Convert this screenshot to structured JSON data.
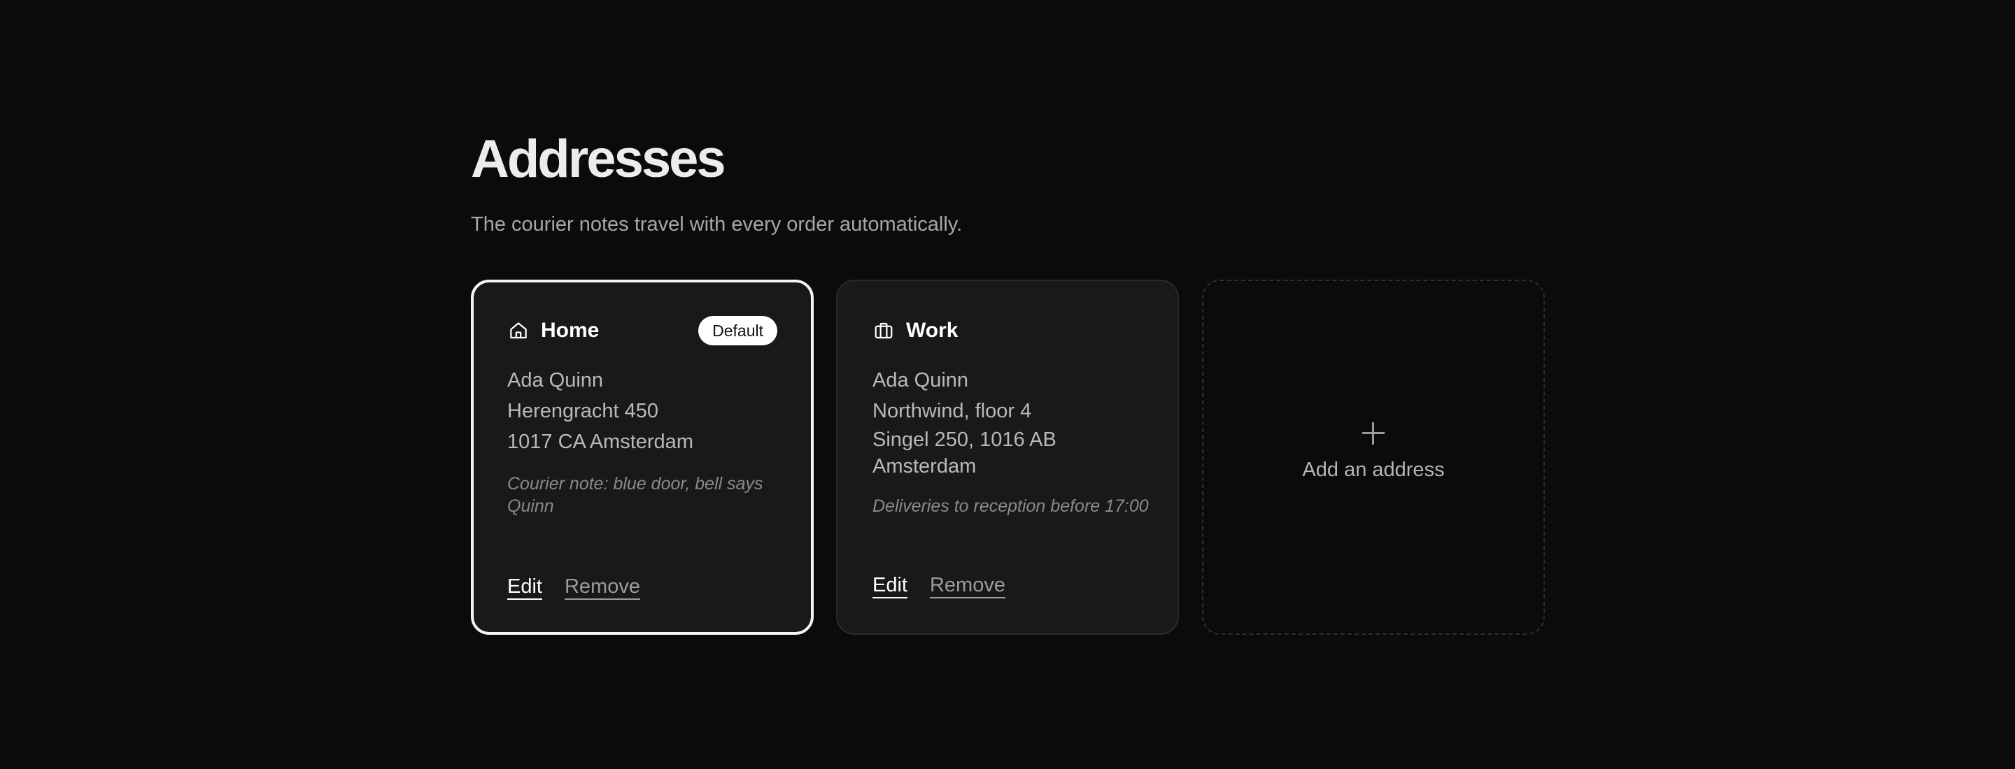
{
  "page": {
    "title": "Addresses",
    "subtitle": "The courier notes travel with every order automatically."
  },
  "addresses": [
    {
      "label": "Home",
      "icon": "home-icon",
      "badge": "Default",
      "lines": [
        "Ada Quinn",
        "Herengracht 450",
        "1017 CA Amsterdam"
      ],
      "note": "Courier note: blue door, bell says Quinn",
      "edit_label": "Edit",
      "remove_label": "Remove"
    },
    {
      "label": "Work",
      "icon": "briefcase-icon",
      "lines": [
        "Ada Quinn",
        "Northwind, floor 4",
        "Singel 250, 1016 AB Amsterdam"
      ],
      "note": "Deliveries to reception before 17:00",
      "edit_label": "Edit",
      "remove_label": "Remove"
    }
  ],
  "add_card": {
    "icon": "plus-icon",
    "label": "Add an address"
  },
  "colors": {
    "background": "#0b0b0b",
    "card": "#191919",
    "selected_border": "#f5f5f5"
  }
}
